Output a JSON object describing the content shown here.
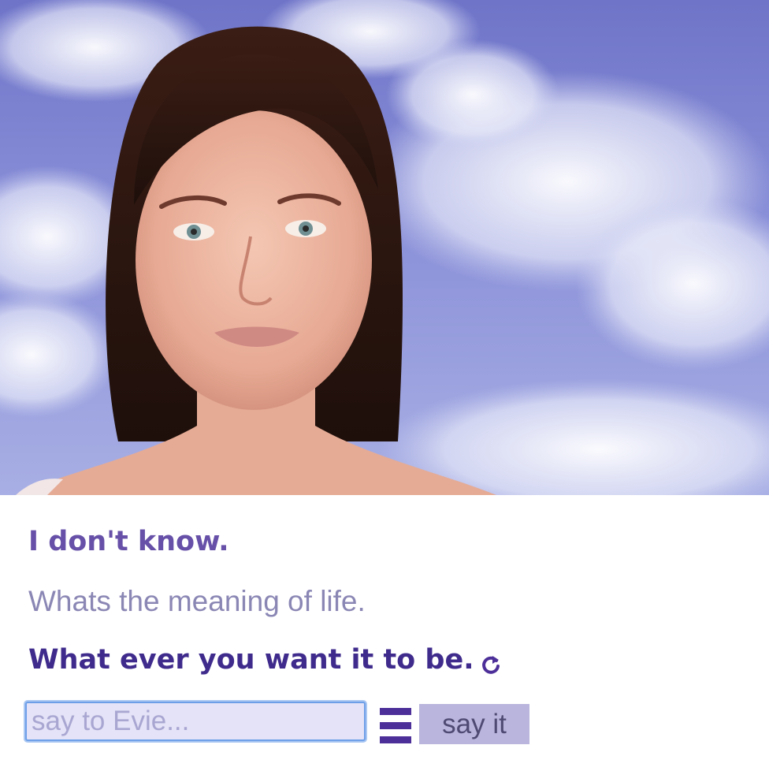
{
  "avatar": {
    "name": "Evie"
  },
  "conversation": {
    "previous_bot": "I don't know.",
    "user_said": "Whats the meaning of life.",
    "bot_reply": "What ever you want it to be."
  },
  "input": {
    "placeholder": "say to Evie...",
    "value": ""
  },
  "controls": {
    "say_button": "say it",
    "menu_icon": "hamburger-menu-icon",
    "refresh_icon": "refresh-icon"
  },
  "colors": {
    "accent": "#4d2f99",
    "bot_text": "#3f2b8c",
    "prev_bot_text": "#6650a8",
    "user_text": "#8b87b5",
    "input_bg": "#e4e3f7",
    "button_bg": "#b9b5dc"
  }
}
